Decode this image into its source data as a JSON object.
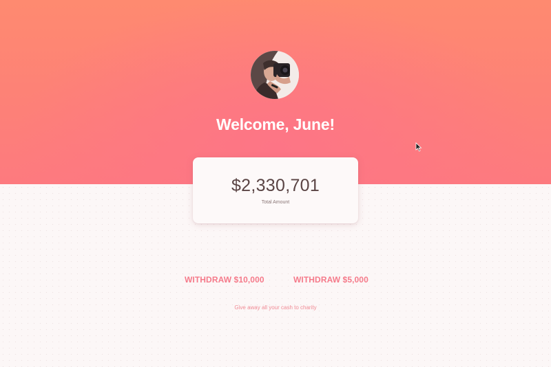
{
  "header": {
    "welcome": "Welcome, June!",
    "avatar_icon": "user-photo-avatar"
  },
  "balance": {
    "amount": "$2,330,701",
    "label": "Total Amount"
  },
  "actions": {
    "withdraw_10k": "WITHDRAW $10,000",
    "withdraw_5k": "WITHDRAW $5,000",
    "charity": "Give away all your cash to charity"
  },
  "colors": {
    "hero_top": "#fe8a70",
    "hero_center": "#fd7586",
    "accent": "#f57a8a",
    "amount_text": "#5a4444",
    "background": "#fcf7f7"
  },
  "icons": {
    "cursor": "mouse-pointer-icon"
  }
}
